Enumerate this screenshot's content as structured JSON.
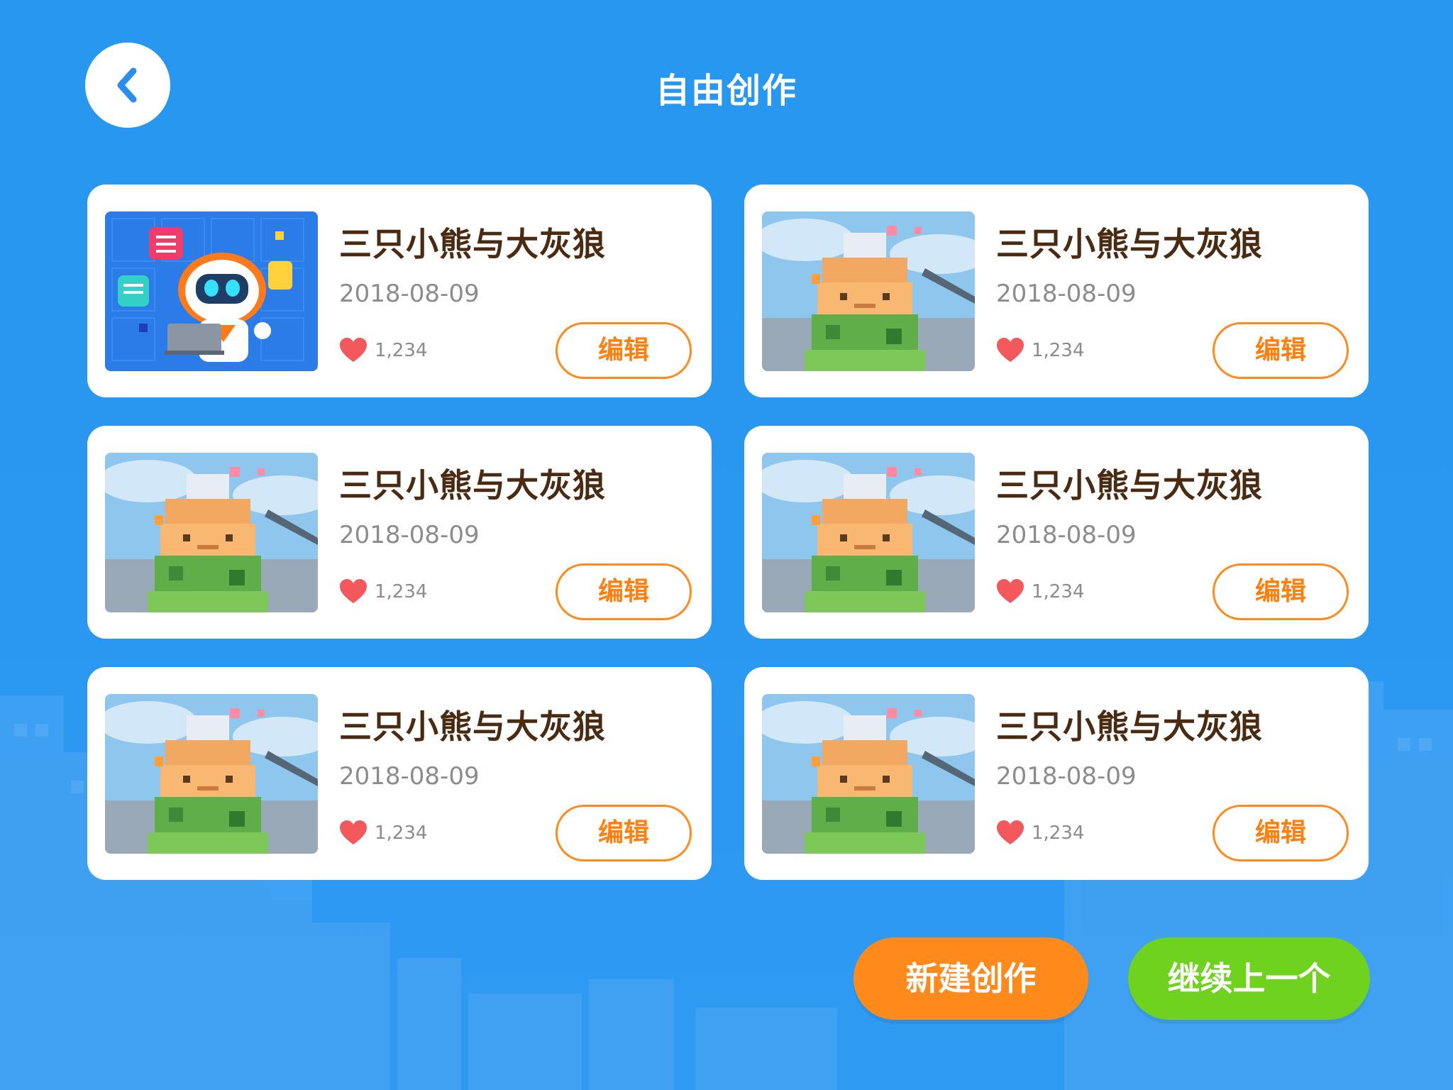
{
  "header": {
    "title": "自由创作",
    "back_icon": "chevron-left-icon"
  },
  "works": [
    {
      "title": "三只小熊与大灰狼",
      "date": "2018-08-09",
      "likes": "1,234",
      "edit_label": "编辑",
      "thumbnail": "robot"
    },
    {
      "title": "三只小熊与大灰狼",
      "date": "2018-08-09",
      "likes": "1,234",
      "edit_label": "编辑",
      "thumbnail": "block-tower"
    },
    {
      "title": "三只小熊与大灰狼",
      "date": "2018-08-09",
      "likes": "1,234",
      "edit_label": "编辑",
      "thumbnail": "block-tower"
    },
    {
      "title": "三只小熊与大灰狼",
      "date": "2018-08-09",
      "likes": "1,234",
      "edit_label": "编辑",
      "thumbnail": "block-tower"
    },
    {
      "title": "三只小熊与大灰狼",
      "date": "2018-08-09",
      "likes": "1,234",
      "edit_label": "编辑",
      "thumbnail": "block-tower"
    },
    {
      "title": "三只小熊与大灰狼",
      "date": "2018-08-09",
      "likes": "1,234",
      "edit_label": "编辑",
      "thumbnail": "block-tower"
    }
  ],
  "actions": {
    "new_label": "新建创作",
    "continue_label": "继续上一个"
  },
  "colors": {
    "background": "#2a97f1",
    "title_text": "#4b2a12",
    "accent_orange": "#ff8a1c",
    "accent_green": "#6fd21f",
    "heart": "#f3585c",
    "muted_text": "#8c8c8c"
  }
}
